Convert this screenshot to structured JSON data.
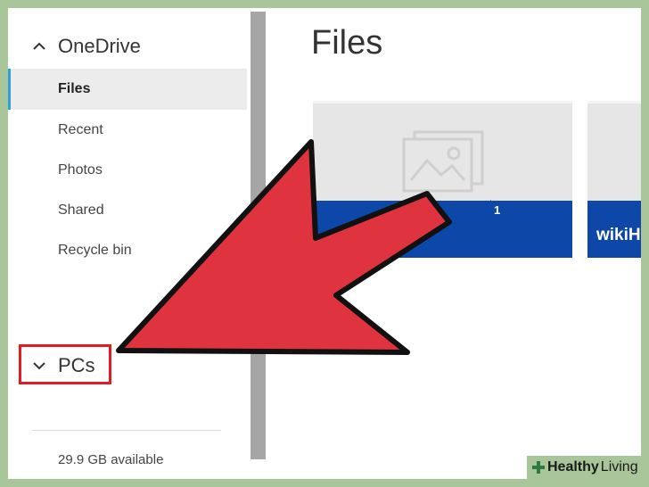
{
  "sidebar": {
    "onedrive_label": "OneDrive",
    "items": [
      {
        "label": "Files"
      },
      {
        "label": "Recent"
      },
      {
        "label": "Photos"
      },
      {
        "label": "Shared"
      },
      {
        "label": "Recycle bin"
      }
    ],
    "pcs_label": "PCs",
    "storage_text": "29.9 GB available"
  },
  "main": {
    "title": "Files",
    "tiles": [
      {
        "name": "",
        "count": "1"
      },
      {
        "name": "wikiH"
      }
    ]
  },
  "logo": {
    "word1": "Healthy",
    "word2": "Living"
  },
  "colors": {
    "accent": "#2ea1dc",
    "tile_blue": "#0d47a8",
    "arrow_red": "#e03340",
    "highlight_red": "#e31b23",
    "background_green": "#a9c59a"
  }
}
